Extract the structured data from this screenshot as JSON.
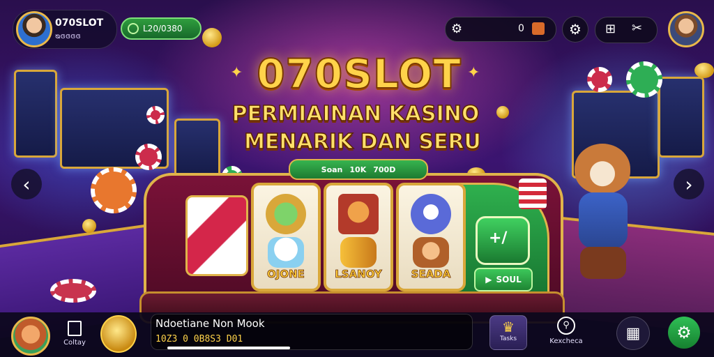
{
  "profile": {
    "name": "070SLOT",
    "subtitle": "ᴓɞɞɞɞ"
  },
  "balance": {
    "value": "L20/0380"
  },
  "coins": {
    "value": "0"
  },
  "hero": {
    "title": "070SLOT",
    "subtitle_line1": "PERMIAINAN KASINO",
    "subtitle_line2": "MENARIK DAN SERU"
  },
  "machine": {
    "top_label_1": "Soan",
    "top_label_2": "10K",
    "top_label_3": "700D",
    "reels": [
      {
        "label": "OJONE"
      },
      {
        "label": "LSANOY"
      },
      {
        "label": "SEADA"
      }
    ],
    "spin_label": "SOUL",
    "big_button_symbol": "+/"
  },
  "bottom": {
    "left_button_label": "Coltay",
    "ticker_title": "Ndoetiane Non Mook",
    "ticker_number": "10Z3 0 0B8S3 D01",
    "tasks_label": "Tasks",
    "rewards_label": "Kexcheca"
  },
  "colors": {
    "accent_gold": "#ffd34a",
    "accent_green": "#2fbf56",
    "bg_purple": "#3b1470"
  }
}
